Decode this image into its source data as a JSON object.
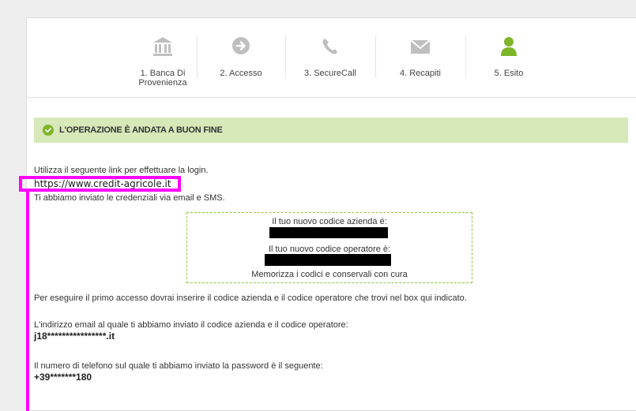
{
  "steps": [
    {
      "label": "1. Banca Di Provenienza",
      "icon": "bank-icon",
      "active": false
    },
    {
      "label": "2. Accesso",
      "icon": "arrow-circle-icon",
      "active": false
    },
    {
      "label": "3. SecureCall",
      "icon": "phone-icon",
      "active": false
    },
    {
      "label": "4. Recapiti",
      "icon": "envelope-icon",
      "active": false
    },
    {
      "label": "5. Esito",
      "icon": "user-icon",
      "active": true
    }
  ],
  "colors": {
    "active": "#7fb52a",
    "inactive": "#bfbfbf",
    "highlight": "#ff00ff",
    "success_bg": "#d7e8b9"
  },
  "success": {
    "text": "L'OPERAZIONE È ANDATA A BUON FINE"
  },
  "body": {
    "intro": "Utilizza il seguente link per effettuare la login.",
    "link": "https://www.credit-agricole.it",
    "credentials_sent": "Ti abbiamo inviato le credenziali via email e SMS.",
    "codes_box": {
      "company_code_label": "Il tuo nuovo codice azienda è:",
      "operator_code_label": "Il tuo nuovo codice operatore è:",
      "memo": "Memorizza i codici e conservali con cura"
    },
    "first_access": "Per eseguire il primo accesso dovrai inserire il codice azienda e il codice operatore che trovi nel box qui indicato.",
    "email_label": "L'indirizzo email al quale ti abbiamo inviato il codice azienda e il codice operatore:",
    "email_value": "j18****************.it",
    "phone_label": "Il numero di telefono sul quale ti abbiamo inviato la password è il seguente:",
    "phone_value": "+39*******180"
  }
}
